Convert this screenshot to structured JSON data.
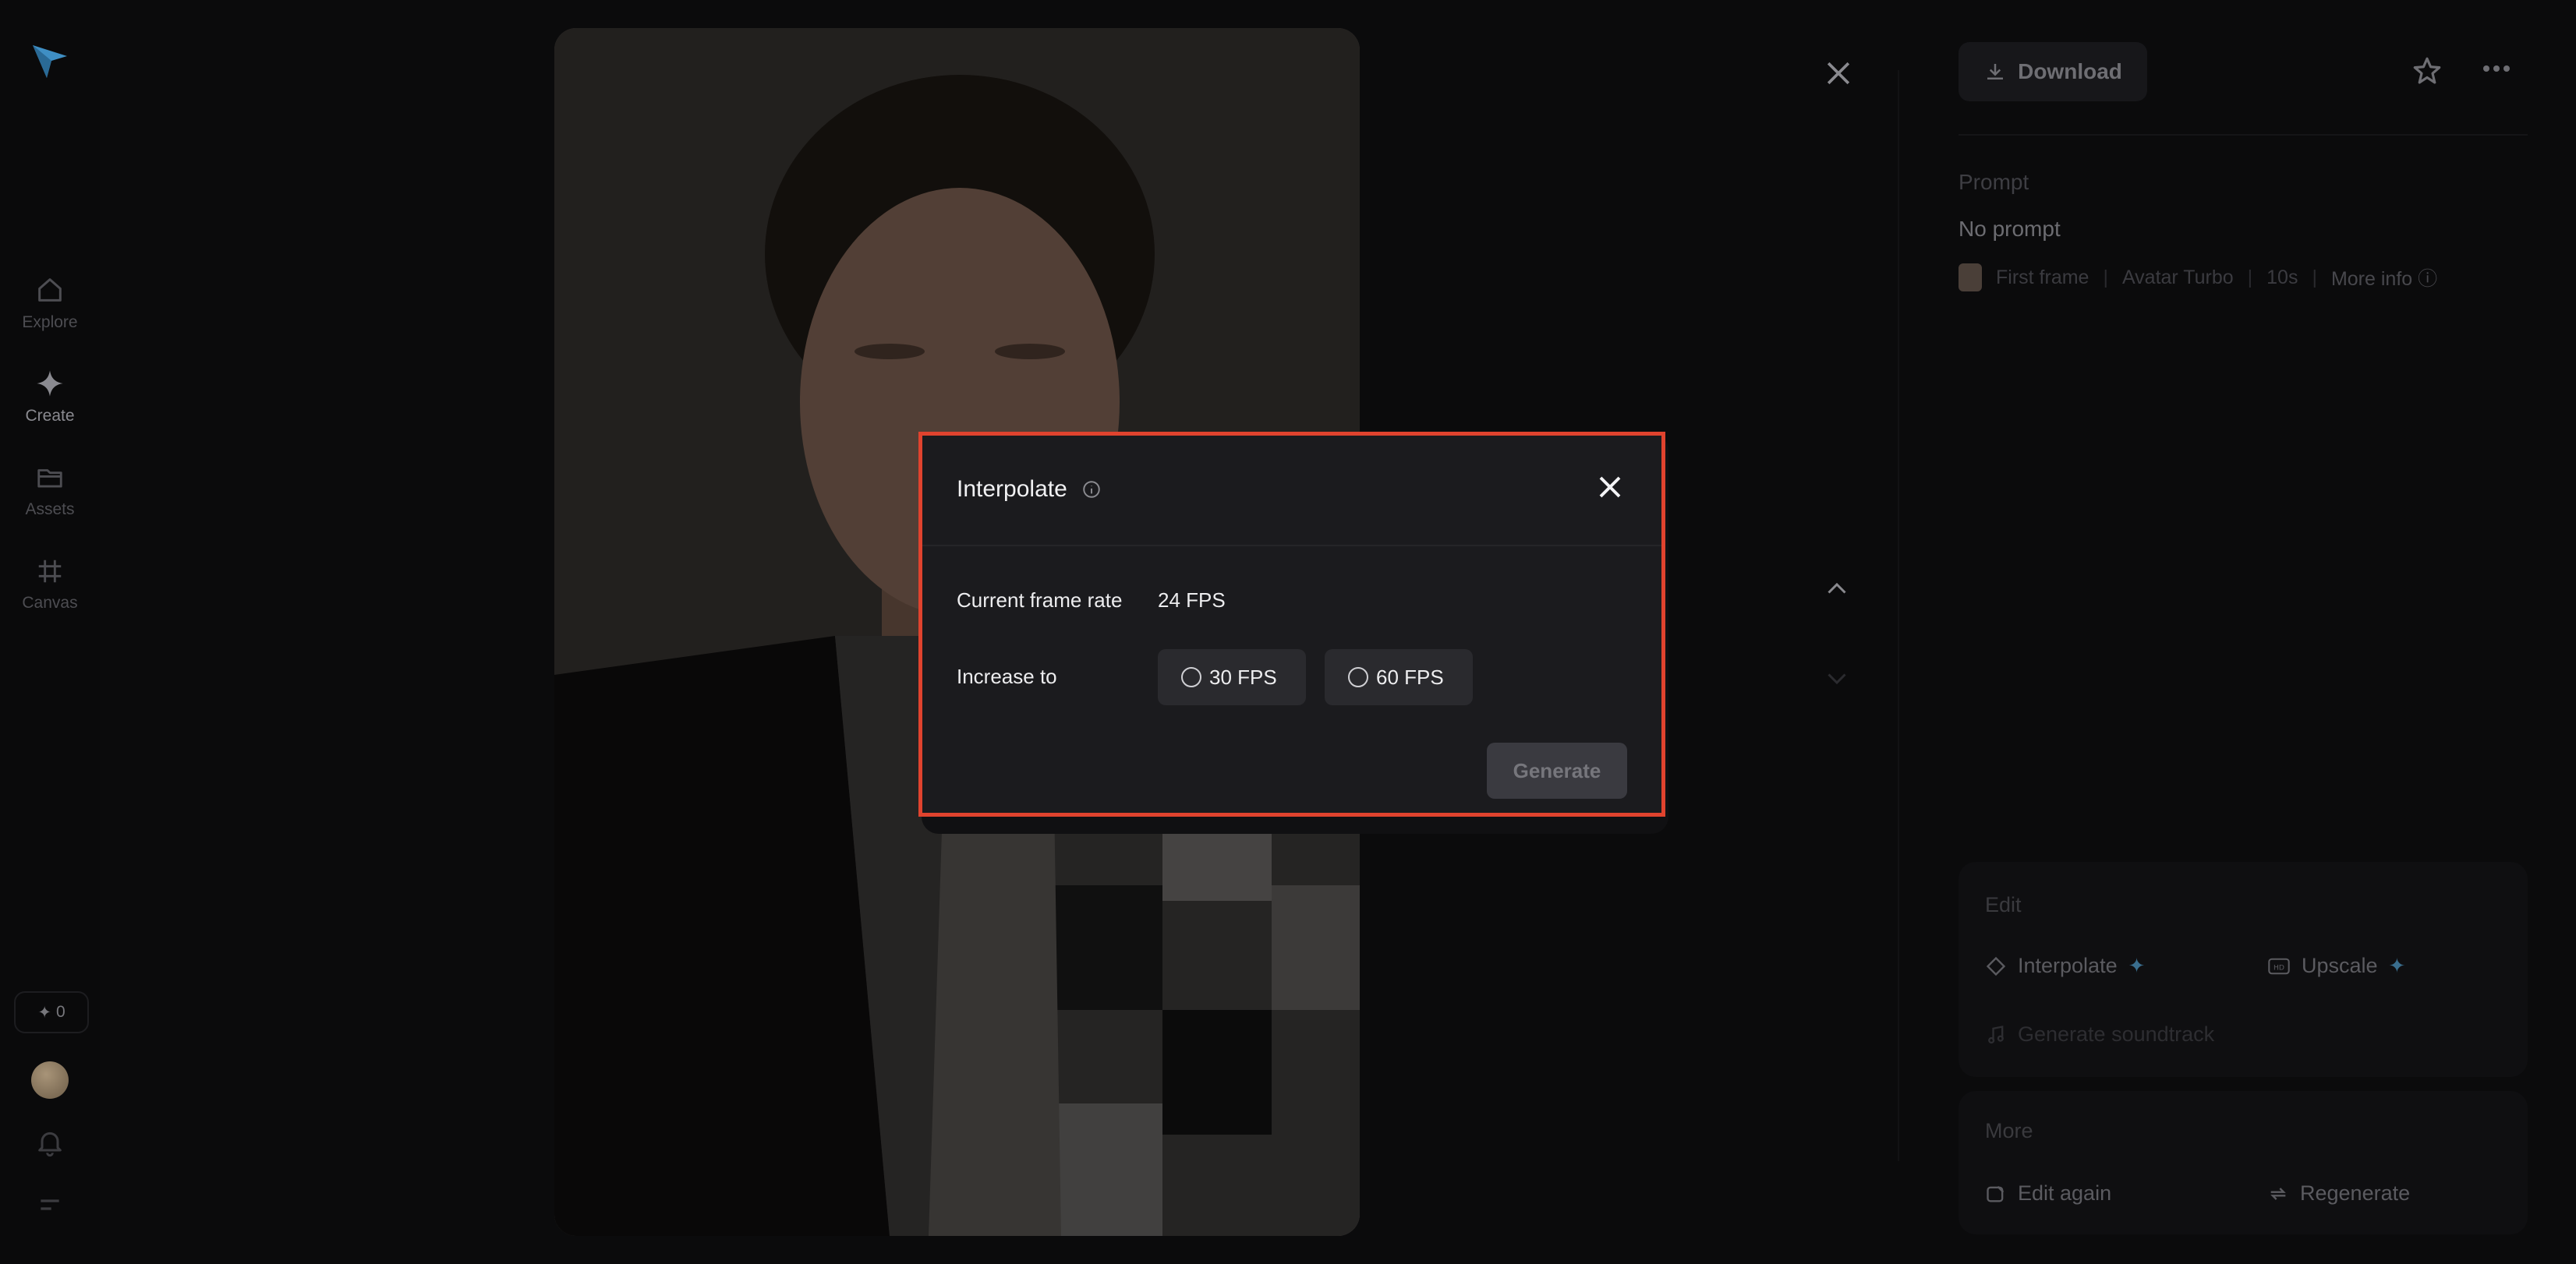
{
  "sidebar": {
    "items": [
      {
        "label": "Explore",
        "icon": "home-icon",
        "active": false
      },
      {
        "label": "Create",
        "icon": "sparkle-icon",
        "active": true
      },
      {
        "label": "Assets",
        "icon": "folder-icon",
        "active": false
      },
      {
        "label": "Canvas",
        "icon": "canvas-grid-icon",
        "active": false
      }
    ],
    "credits": "0"
  },
  "panel": {
    "download_label": "Download",
    "prompt_label": "Prompt",
    "prompt_value": "No prompt",
    "meta": {
      "first_frame": "First frame",
      "model": "Avatar Turbo",
      "duration": "10s",
      "more_info": "More info"
    },
    "edit": {
      "title": "Edit",
      "interpolate": "Interpolate",
      "upscale": "Upscale",
      "soundtrack": "Generate soundtrack"
    },
    "more": {
      "title": "More",
      "edit_again": "Edit again",
      "regenerate": "Regenerate"
    }
  },
  "modal": {
    "title": "Interpolate",
    "current_label": "Current frame rate",
    "current_value": "24 FPS",
    "increase_label": "Increase to",
    "options": [
      "30 FPS",
      "60 FPS"
    ],
    "generate_label": "Generate"
  },
  "colors": {
    "highlight_border": "#e0432e",
    "accent": "#3a6e8e"
  }
}
